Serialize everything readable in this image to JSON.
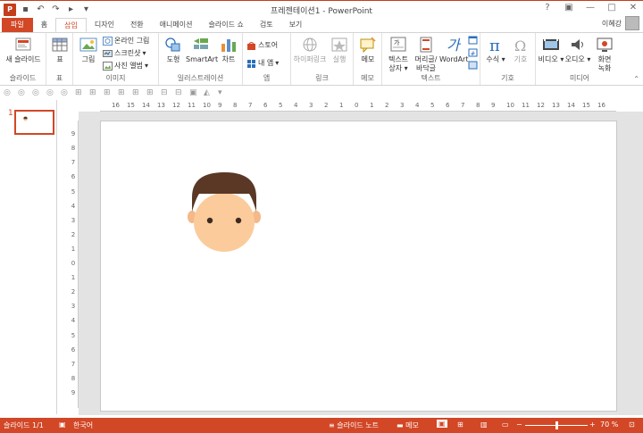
{
  "window": {
    "app_icon": "P",
    "title": "프레젠테이션1 - PowerPoint",
    "controls": [
      "?",
      "▣",
      "—",
      "□",
      "✕"
    ]
  },
  "tabs": [
    "파일",
    "홈",
    "삽입",
    "디자인",
    "전환",
    "애니메이션",
    "슬라이드 쇼",
    "검토",
    "보기"
  ],
  "active_tab": "삽입",
  "user": {
    "name": "이혜강"
  },
  "ribbon": {
    "groups": {
      "slides": "슬라이드",
      "table": "표",
      "images": "이미지",
      "illustrations": "일러스트레이션",
      "apps": "앱",
      "links": "링크",
      "comments": "메모",
      "text": "텍스트",
      "symbols": "기호",
      "media": "미디어"
    },
    "buttons": {
      "new_slide": "새 슬라이드",
      "table": "표",
      "pictures": "그림",
      "online_pictures": "온라인 그림",
      "screenshot": "스크린샷",
      "photo_album": "사진 앨범",
      "shapes": "도형",
      "smartart": "SmartArt",
      "chart": "차트",
      "store": "스토어",
      "my_apps": "내 앱",
      "hyperlink": "하이퍼링크",
      "action": "실행",
      "comment": "메모",
      "textbox_1": "텍스트",
      "textbox_2": "상자",
      "header_footer_1": "머리글/",
      "header_footer_2": "바닥글",
      "wordart": "WordArt",
      "equation": "수식",
      "symbol": "기호",
      "video": "비디오",
      "audio": "오디오",
      "screen_recording_1": "화면",
      "screen_recording_2": "녹화"
    }
  },
  "thumbnail_pane": {
    "slide_number": "1"
  },
  "ruler_h_labels": [
    "16",
    "15",
    "14",
    "13",
    "12",
    "11",
    "10",
    "9",
    "8",
    "7",
    "6",
    "5",
    "4",
    "3",
    "2",
    "1",
    "0",
    "1",
    "2",
    "3",
    "4",
    "5",
    "6",
    "7",
    "8",
    "9",
    "10",
    "11",
    "12",
    "13",
    "14",
    "15",
    "16"
  ],
  "ruler_v_labels": [
    "9",
    "8",
    "7",
    "6",
    "5",
    "4",
    "3",
    "2",
    "1",
    "0",
    "1",
    "2",
    "3",
    "4",
    "5",
    "6",
    "7",
    "8",
    "9"
  ],
  "statusbar": {
    "slide_info": "슬라이드 1/1",
    "language": "한국어",
    "notes": "슬라이드 노트",
    "comments": "메모",
    "zoom": "70 %",
    "zoom_fraction": 0.5
  },
  "colors": {
    "accent": "#D24726",
    "hair": "#5A3825",
    "skin": "#FCCB9B",
    "ear": "#F5B888",
    "eyes": "#3A2A22"
  }
}
